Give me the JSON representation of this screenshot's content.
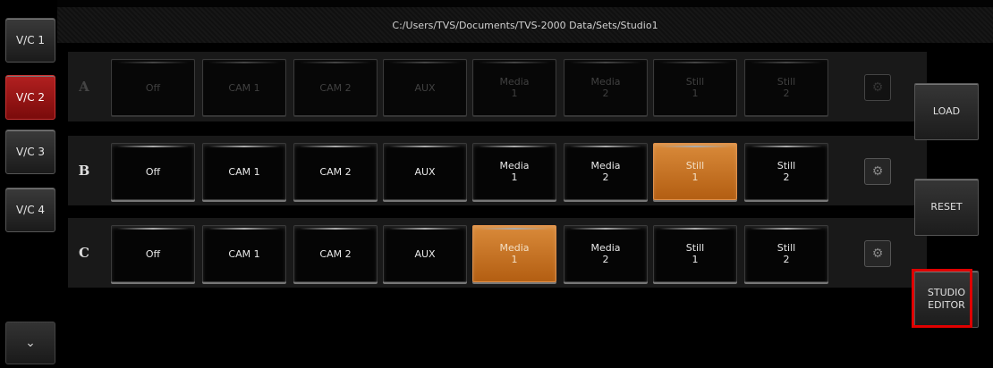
{
  "header": {
    "path": "C:/Users/TVS/Documents/TVS-2000 Data/Sets/Studio1"
  },
  "vc_tabs": [
    {
      "label": "V/C 1",
      "active": false
    },
    {
      "label": "V/C 2",
      "active": true
    },
    {
      "label": "V/C 3",
      "active": false
    },
    {
      "label": "V/C 4",
      "active": false
    }
  ],
  "rows": [
    {
      "letter": "A",
      "dimmed": true,
      "buttons": [
        "Off",
        "CAM 1",
        "CAM 2",
        "AUX",
        "Media\n1",
        "Media\n2",
        "Still\n1",
        "Still\n2"
      ],
      "active_index": -1
    },
    {
      "letter": "B",
      "dimmed": false,
      "buttons": [
        "Off",
        "CAM 1",
        "CAM 2",
        "AUX",
        "Media\n1",
        "Media\n2",
        "Still\n1",
        "Still\n2"
      ],
      "active_index": 6
    },
    {
      "letter": "C",
      "dimmed": false,
      "buttons": [
        "Off",
        "CAM 1",
        "CAM 2",
        "AUX",
        "Media\n1",
        "Media\n2",
        "Still\n1",
        "Still\n2"
      ],
      "active_index": 4
    }
  ],
  "side_buttons": {
    "load": "LOAD",
    "reset": "RESET",
    "studio_editor": "STUDIO\nEDITOR"
  },
  "icons": {
    "gear": "gear-icon",
    "scroll_down": "chevron-down-icon"
  },
  "colors": {
    "active_tab": "#b22020",
    "active_source": "#d98a3a",
    "highlight": "#e00000"
  }
}
